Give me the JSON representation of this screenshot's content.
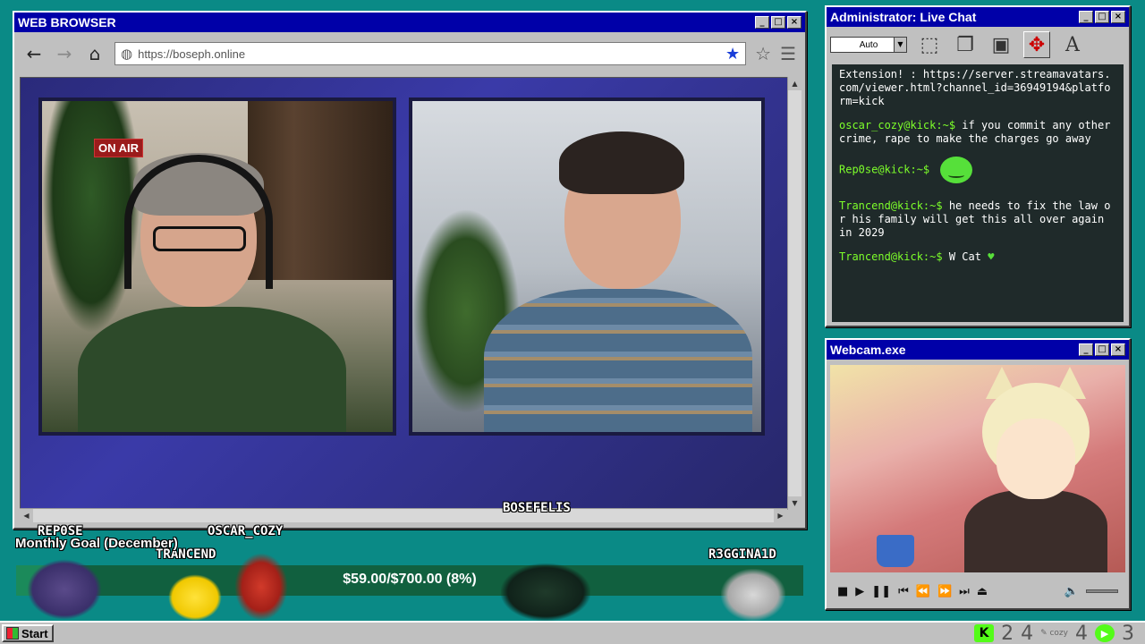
{
  "browser": {
    "title": "WEB BROWSER",
    "url": "https://boseph.online",
    "streamer_name": "BOSEFELIS",
    "onair": "ON AIR"
  },
  "chat": {
    "title": "Administrator: Live Chat",
    "size_select": "Auto",
    "messages": [
      {
        "user": "",
        "text": "Extension! : https://server.streamavatars.com/viewer.html?channel_id=36949194&platform=kick"
      },
      {
        "user": "oscar_cozy@kick:~$",
        "text": " if you commit any other crime, rape to make the charges go away"
      },
      {
        "user": "Rep0se@kick:~$",
        "text": ""
      },
      {
        "user": "Trancend@kick:~$",
        "text": " he needs to fix the law or his family will get this all over again in 2029"
      },
      {
        "user": "Trancend@kick:~$",
        "text": " W Cat"
      }
    ]
  },
  "webcam": {
    "title": "Webcam.exe"
  },
  "overlay": {
    "names": [
      "REP0SE",
      "TRANCEND",
      "OSCAR_COZY",
      "R3GGINA1D"
    ],
    "goal_title": "Monthly Goal (December)",
    "goal_text": "$59.00/$700.00 (8%)",
    "goal_progress": 0.08
  },
  "taskbar": {
    "start": "Start",
    "counts": [
      "2",
      "4",
      "4",
      "3"
    ]
  }
}
